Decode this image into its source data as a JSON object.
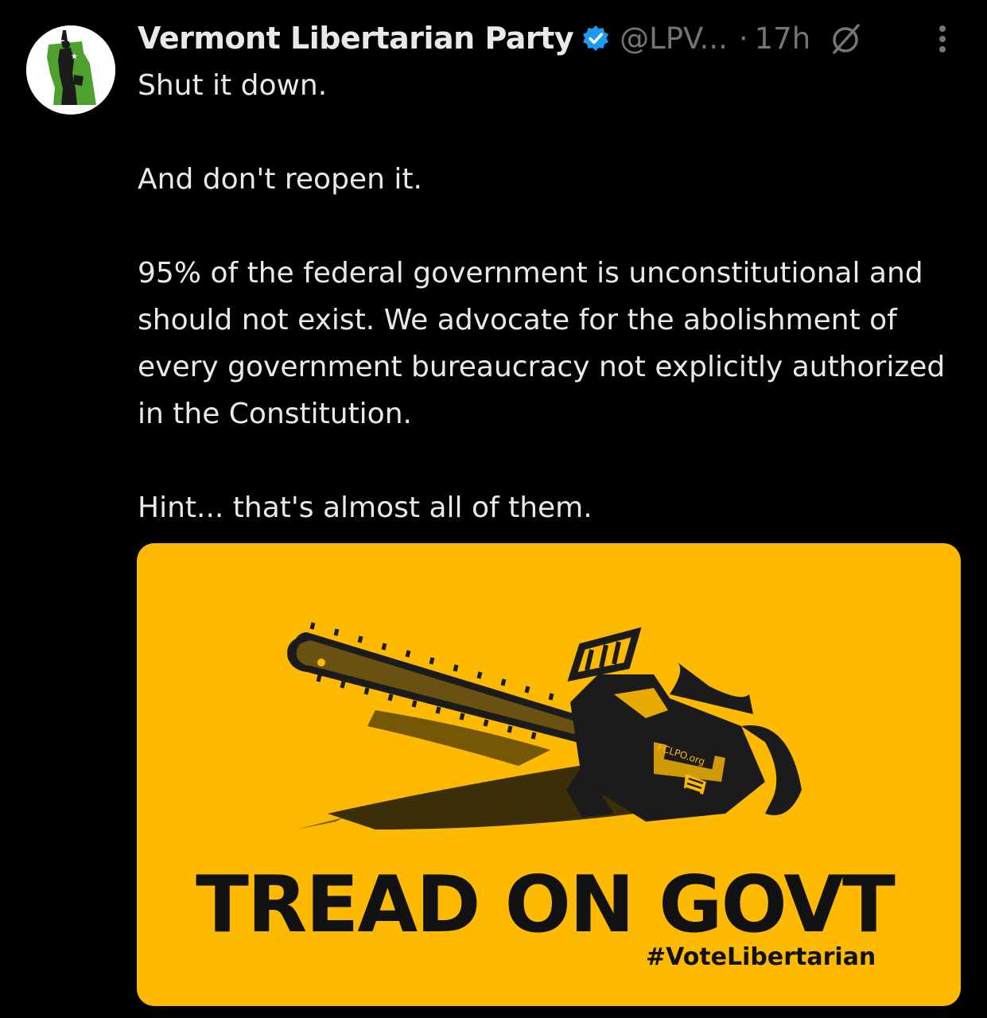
{
  "author": {
    "display_name": "Vermont Libertarian Party",
    "handle": "@LPV...",
    "separator": "·",
    "timestamp": "17h",
    "avatar_icon": "statue-of-liberty-vermont-icon",
    "verified_icon": "verified-badge-icon",
    "verified_color": "#1d9bf0"
  },
  "tweet": {
    "lines": [
      "Shut it down.",
      "And don't reopen it.",
      "95% of the federal government is unconstitutional and should not exist. We advocate for the abolishment of every government bureaucracy not explicitly authorized in the Constitution.",
      "Hint... that's almost all of them."
    ]
  },
  "media": {
    "title": "TREAD ON GOVT",
    "hashtag": "#VoteLibertarian",
    "chainsaw_label": "FCLPO.org",
    "background_color": "#fdba01"
  },
  "icons": {
    "more": "more-options-icon",
    "grok": "null-slash-icon"
  },
  "colors": {
    "background": "#000000",
    "text": "#e7e9ea",
    "secondary_text": "#71767b"
  }
}
